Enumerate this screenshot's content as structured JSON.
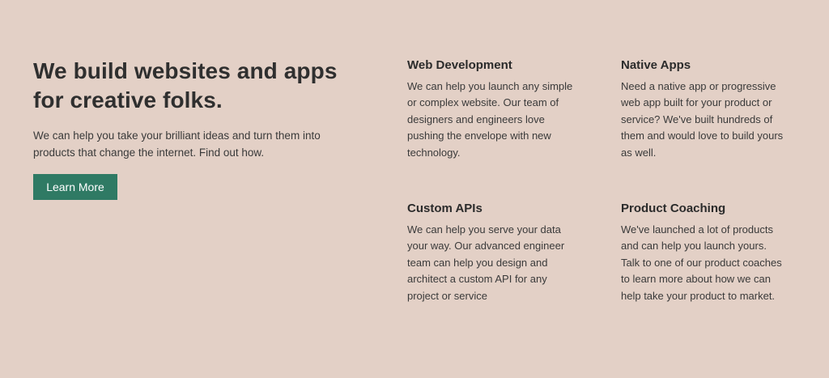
{
  "hero": {
    "title": "We build websites and apps for creative folks.",
    "description": "We can help you take your brilliant ideas and turn them into products that change the internet. Find out how.",
    "cta_label": "Learn More"
  },
  "features": [
    {
      "title": "Web Development",
      "description": "We can help you launch any simple or complex website. Our team of designers and engineers love pushing the envelope with new technology."
    },
    {
      "title": "Native Apps",
      "description": "Need a native app or progressive web app built for your product or service? We've built hundreds of them and would love to build yours as well."
    },
    {
      "title": "Custom APIs",
      "description": "We can help you serve your data your way. Our advanced engineer team can help you design and architect a custom API for any project or service"
    },
    {
      "title": "Product Coaching",
      "description": "We've launched a lot of products and can help you launch yours. Talk to one of our product coaches to learn more about how we can help take your product to market."
    }
  ],
  "colors": {
    "background": "#e3d0c6",
    "accent": "#2f7a64",
    "text": "#2b2b2b"
  }
}
